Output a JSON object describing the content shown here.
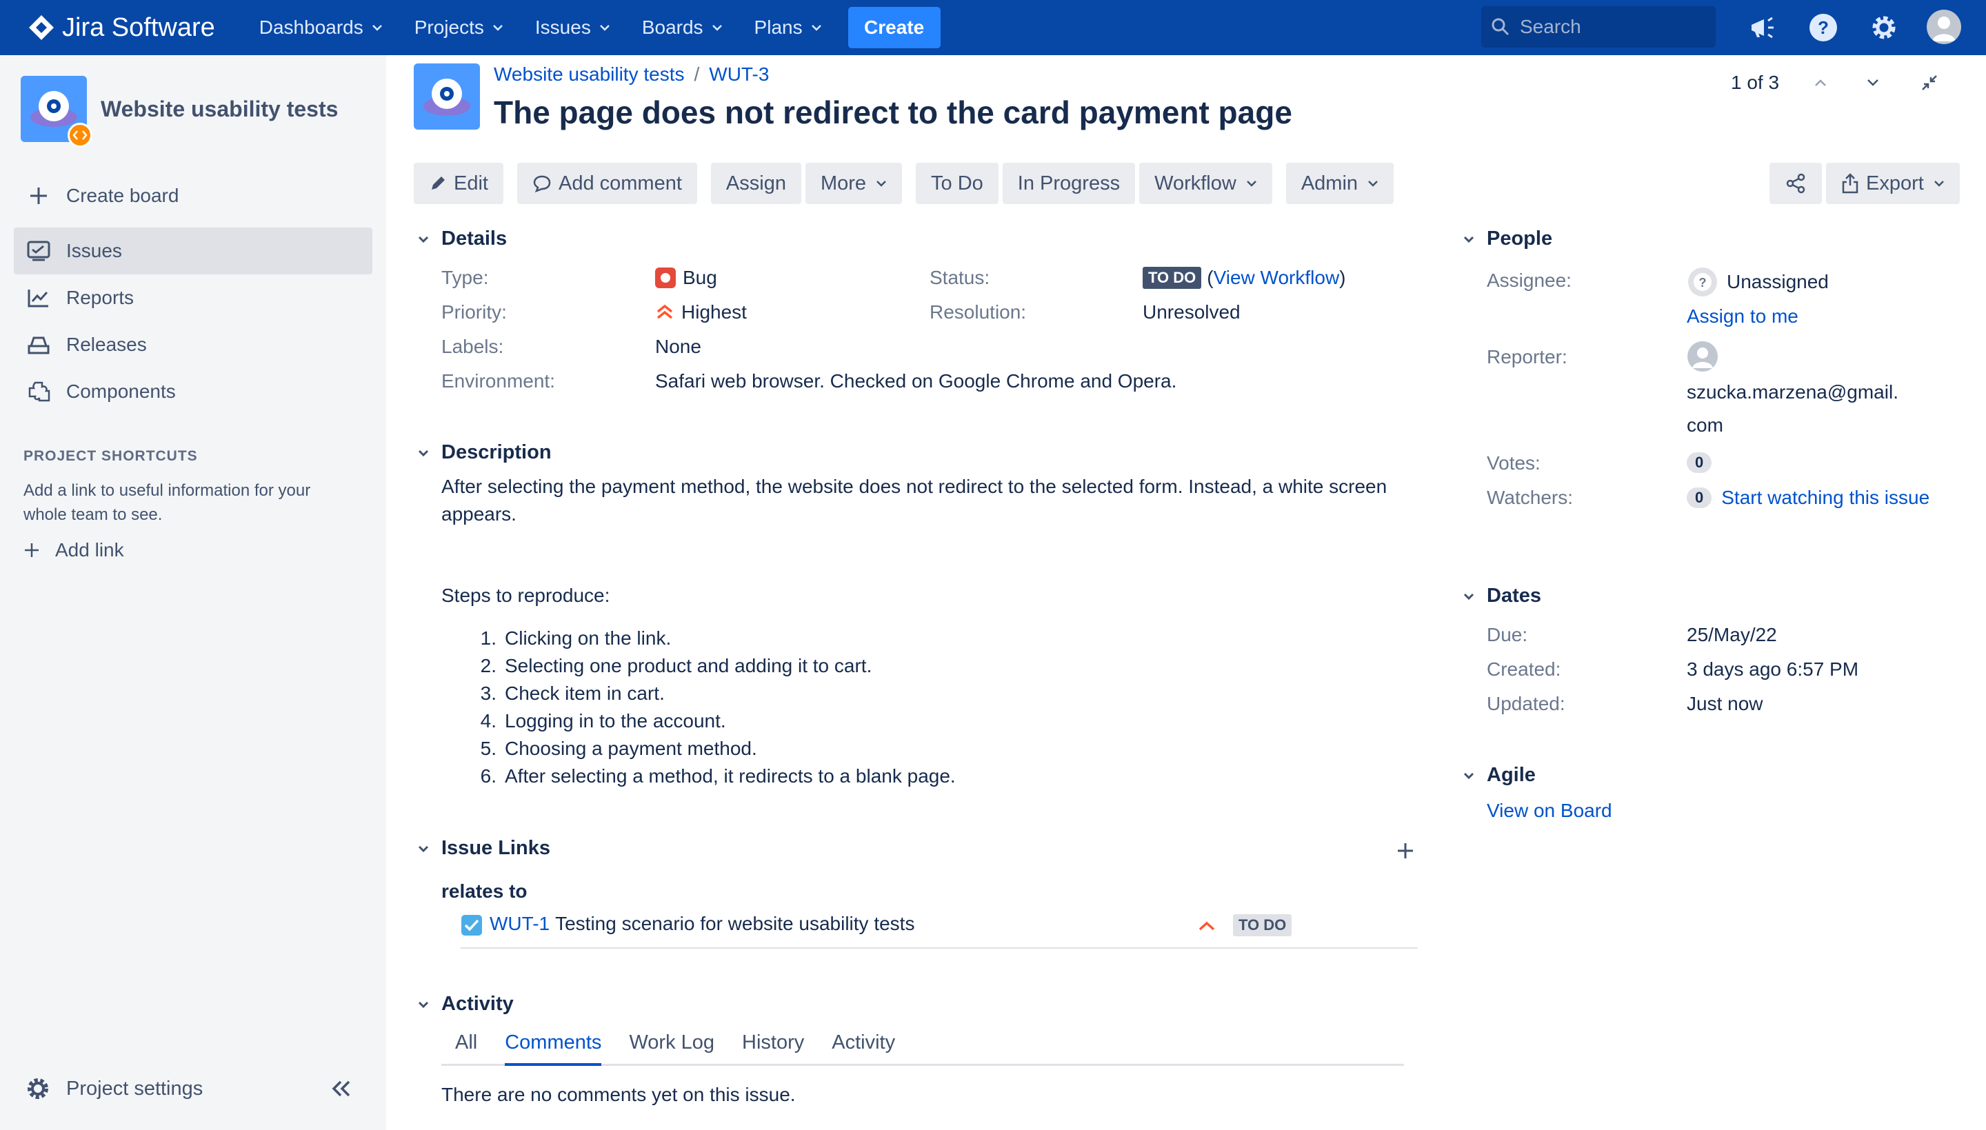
{
  "topnav": {
    "logo_text": "Jira Software",
    "items": [
      {
        "label": "Dashboards"
      },
      {
        "label": "Projects"
      },
      {
        "label": "Issues"
      },
      {
        "label": "Boards"
      },
      {
        "label": "Plans"
      }
    ],
    "create_label": "Create",
    "search_placeholder": "Search",
    "icons": [
      "notifications-icon",
      "help-icon",
      "settings-icon",
      "user-avatar"
    ]
  },
  "sidebar": {
    "project_name": "Website usability tests",
    "create_board": "Create board",
    "items": [
      {
        "label": "Issues",
        "icon": "issues-icon",
        "active": true
      },
      {
        "label": "Reports",
        "icon": "reports-icon"
      },
      {
        "label": "Releases",
        "icon": "releases-icon"
      },
      {
        "label": "Components",
        "icon": "components-icon"
      }
    ],
    "shortcuts_heading": "PROJECT SHORTCUTS",
    "shortcuts_text": "Add a link to useful information for your whole team to see.",
    "add_link": "Add link",
    "project_settings": "Project settings"
  },
  "issue": {
    "breadcrumb": [
      "Website usability tests",
      "WUT-3"
    ],
    "title": "The page does not redirect to the card payment page",
    "pager": "1 of 3",
    "toolbar": {
      "edit": "Edit",
      "add_comment": "Add comment",
      "assign": "Assign",
      "more": "More",
      "todo": "To Do",
      "in_progress": "In Progress",
      "workflow": "Workflow",
      "admin": "Admin",
      "export": "Export"
    },
    "details": {
      "heading": "Details",
      "type_label": "Type:",
      "type_value": "Bug",
      "priority_label": "Priority:",
      "priority_value": "Highest",
      "labels_label": "Labels:",
      "labels_value": "None",
      "environment_label": "Environment:",
      "environment_value": "Safari web browser. Checked on Google Chrome and Opera.",
      "status_label": "Status:",
      "status_value": "TO DO",
      "view_workflow": "View Workflow",
      "resolution_label": "Resolution:",
      "resolution_value": "Unresolved"
    },
    "description": {
      "heading": "Description",
      "text": "After selecting the payment method, the website does not redirect to the selected form. Instead, a white screen appears.",
      "steps_heading": "Steps to reproduce:",
      "steps": [
        "Clicking on the link.",
        "Selecting  one product and adding it to cart.",
        "Check item in cart.",
        "Logging in to the account.",
        "Choosing a payment method.",
        "After selecting a method, it redirects to a blank page."
      ]
    },
    "links": {
      "heading": "Issue Links",
      "relation": "relates to",
      "key": "WUT-1",
      "summary": "Testing scenario for website usability tests",
      "status": "TO DO"
    },
    "activity": {
      "heading": "Activity",
      "tabs": [
        "All",
        "Comments",
        "Work Log",
        "History",
        "Activity"
      ],
      "active_tab": "Comments",
      "empty_text": "There are no comments yet on this issue."
    }
  },
  "people": {
    "heading": "People",
    "assignee_label": "Assignee:",
    "assignee_value": "Unassigned",
    "assign_to_me": "Assign to me",
    "reporter_label": "Reporter:",
    "reporter_line1": "szucka.marzena@gmail.",
    "reporter_line2": "com",
    "votes_label": "Votes:",
    "votes_count": "0",
    "watchers_label": "Watchers:",
    "watchers_count": "0",
    "start_watching": "Start watching this issue"
  },
  "dates": {
    "heading": "Dates",
    "due_label": "Due:",
    "due_value": "25/May/22",
    "created_label": "Created:",
    "created_value": "3 days ago 6:57 PM",
    "updated_label": "Updated:",
    "updated_value": "Just now"
  },
  "agile": {
    "heading": "Agile",
    "view_on_board": "View on Board"
  },
  "colors": {
    "nav_bg": "#0747a6",
    "accent": "#0052cc",
    "bug": "#e5493a",
    "priority_highest": "#ff5630"
  }
}
